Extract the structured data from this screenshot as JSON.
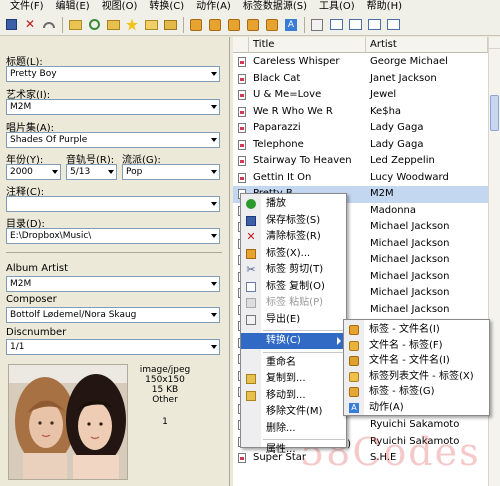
{
  "menubar": [
    "文件(F)",
    "编辑(E)",
    "视图(O)",
    "转换(C)",
    "动作(A)",
    "标签数据源(S)",
    "工具(O)",
    "帮助(H)"
  ],
  "toolbar": [
    "save-icon",
    "delete-icon",
    "undo-icon",
    "open-folder-icon",
    "refresh-icon",
    "folder-icon",
    "favorites-star-icon",
    "folder-open-icon",
    "folder-add-icon",
    "tag-convert-icon",
    "tag-convert-icon",
    "tag-convert-icon",
    "tag-convert-icon",
    "tag-convert-icon",
    "action-icon",
    "export-icon",
    "list-view-icon",
    "list-view-icon",
    "list-view-icon",
    "list-view-icon"
  ],
  "tag_panel": {
    "title_label": "标题(L):",
    "title_value": "Pretty Boy",
    "artist_label": "艺术家(I):",
    "artist_value": "M2M",
    "album_label": "唱片集(A):",
    "album_value": "Shades Of Purple",
    "year_label": "年份(Y):",
    "year_value": "2000",
    "track_label": "音轨号(R):",
    "track_value": "5/13",
    "genre_label": "流派(G):",
    "genre_value": "Pop",
    "comment_label": "注释(C):",
    "comment_value": "",
    "directory_label": "目录(D):",
    "directory_value": "E:\\Dropbox\\Music\\",
    "album_artist_label": "Album Artist",
    "album_artist_value": "M2M",
    "composer_label": "Composer",
    "composer_value": "Bottolf Lødemel/Nora Skaug",
    "discnumber_label": "Discnumber",
    "discnumber_value": "1/1",
    "cover": {
      "mime": "image/jpeg",
      "dimensions": "150x150",
      "size": "15 KB",
      "type": "Other",
      "index": "1"
    }
  },
  "file_list": {
    "columns": [
      "Title",
      "Artist"
    ],
    "rows": [
      {
        "title": "Careless Whisper",
        "artist": "George Michael"
      },
      {
        "title": "Black Cat",
        "artist": "Janet Jackson"
      },
      {
        "title": "U & Me=Love",
        "artist": "Jewel"
      },
      {
        "title": "We R Who We R",
        "artist": "Ke$ha"
      },
      {
        "title": "Paparazzi",
        "artist": "Lady Gaga"
      },
      {
        "title": "Telephone",
        "artist": "Lady Gaga"
      },
      {
        "title": "Stairway To Heaven",
        "artist": "Led Zeppelin"
      },
      {
        "title": "Gettin It On",
        "artist": "Lucy Woodward"
      },
      {
        "title": "Pretty B",
        "artist": "M2M"
      },
      {
        "title": "",
        "artist": "Madonna"
      },
      {
        "title": "",
        "artist": "Michael Jackson"
      },
      {
        "title": "",
        "artist": "Michael Jackson"
      },
      {
        "title": "",
        "artist": "Michael Jackson"
      },
      {
        "title": "",
        "artist": "Michael Jackson"
      },
      {
        "title": "",
        "artist": "Michael Jackson"
      },
      {
        "title": "",
        "artist": "Michael Jackson"
      },
      {
        "title": "",
        "artist": ""
      },
      {
        "title": "",
        "artist": ""
      },
      {
        "title": "",
        "artist": ""
      },
      {
        "title": "",
        "artist": ""
      },
      {
        "title": "",
        "artist": ""
      },
      {
        "title": "",
        "artist": "Rod Stewart"
      },
      {
        "title": "",
        "artist": "Ryuichi Sakamoto"
      },
      {
        "title": "Where Is Armo",
        "artist": "Ryuichi Sakamoto"
      },
      {
        "title": "Super Star",
        "artist": "S.H.E"
      }
    ],
    "trailing_fragment": "e)"
  },
  "context_menu": {
    "items": [
      {
        "label": "播放",
        "icon": "play-icon",
        "state": "normal"
      },
      {
        "label": "保存标签(S)",
        "icon": "save-icon",
        "state": "normal"
      },
      {
        "label": "清除标签(R)",
        "icon": "clear-icon",
        "state": "normal"
      },
      {
        "label": "标签(X)...",
        "icon": "tag-icon",
        "state": "normal"
      },
      {
        "label": "标签 剪切(T)",
        "icon": "cut-icon",
        "state": "normal"
      },
      {
        "label": "标签 复制(O)",
        "icon": "copy-icon",
        "state": "normal"
      },
      {
        "label": "标签 粘贴(P)",
        "icon": "paste-icon",
        "state": "disabled"
      },
      {
        "label": "导出(E)",
        "icon": "export-icon",
        "state": "normal"
      },
      {
        "label": "转换(C)",
        "icon": "",
        "state": "highlighted"
      },
      {
        "label": "重命名",
        "icon": "",
        "state": "normal"
      },
      {
        "label": "复制到...",
        "icon": "folder-icon",
        "state": "normal"
      },
      {
        "label": "移动到...",
        "icon": "folder-icon",
        "state": "normal"
      },
      {
        "label": "移除文件(M)",
        "icon": "",
        "state": "normal"
      },
      {
        "label": "删除...",
        "icon": "",
        "state": "normal"
      },
      {
        "label": "属性...",
        "icon": "",
        "state": "normal"
      }
    ]
  },
  "submenu": {
    "items": [
      {
        "label": "标签 - 文件名(I)",
        "icon": "tag-to-filename-icon"
      },
      {
        "label": "文件名 - 标签(F)",
        "icon": "filename-to-tag-icon"
      },
      {
        "label": "文件名 - 文件名(I)",
        "icon": "filename-to-filename-icon"
      },
      {
        "label": "标签列表文件 - 标签(X)",
        "icon": "textfile-to-tag-icon"
      },
      {
        "label": "标签 - 标签(G)",
        "icon": "tag-to-tag-icon"
      },
      {
        "label": "动作(A)",
        "icon": "action-icon"
      }
    ]
  },
  "watermark": "58Codes",
  "colors": {
    "selection": "#c4d7f0",
    "menu_highlight": "#316ac5",
    "panel_bg": "#ece9d8"
  }
}
